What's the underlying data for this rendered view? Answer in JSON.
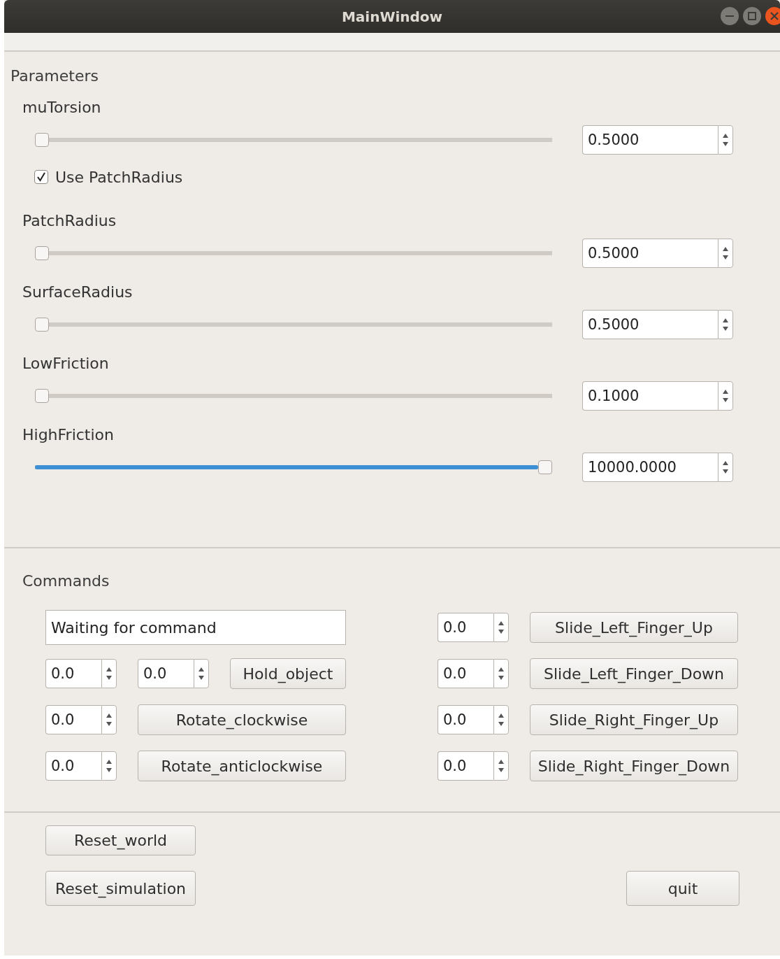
{
  "window": {
    "title": "MainWindow"
  },
  "parameters": {
    "title": "Parameters",
    "items": [
      {
        "kind": "slider",
        "label": "muTorsion",
        "level": 0,
        "value": "0.5000"
      },
      {
        "kind": "checkbox",
        "label": "Use PatchRadius",
        "checked": true
      },
      {
        "kind": "slider",
        "label": "PatchRadius",
        "level": 0,
        "value": "0.5000"
      },
      {
        "kind": "slider",
        "label": "SurfaceRadius",
        "level": 0,
        "value": "0.5000"
      },
      {
        "kind": "slider",
        "label": "LowFriction",
        "level": 0,
        "value": "0.1000"
      },
      {
        "kind": "slider",
        "label": "HighFriction",
        "level": 1,
        "value": "10000.0000"
      }
    ]
  },
  "commands": {
    "title": "Commands",
    "rows": [
      {
        "left": [
          {
            "kind": "status",
            "value": "Waiting for command"
          }
        ],
        "right": {
          "value": "0.0",
          "button": "Slide_Left_Finger_Up"
        }
      },
      {
        "left": [
          {
            "kind": "spin",
            "value": "0.0"
          },
          {
            "kind": "spin",
            "value": "0.0"
          },
          {
            "kind": "button",
            "label": "Hold_object"
          }
        ],
        "right": {
          "value": "0.0",
          "button": "Slide_Left_Finger_Down"
        }
      },
      {
        "left": [
          {
            "kind": "spin",
            "value": "0.0"
          },
          {
            "kind": "button",
            "label": "Rotate_clockwise"
          }
        ],
        "right": {
          "value": "0.0",
          "button": "Slide_Right_Finger_Up"
        }
      },
      {
        "left": [
          {
            "kind": "spin",
            "value": "0.0"
          },
          {
            "kind": "button",
            "label": "Rotate_anticlockwise"
          }
        ],
        "right": {
          "value": "0.0",
          "button": "Slide_Right_Finger_Down"
        }
      }
    ]
  },
  "footer": {
    "reset_world": "Reset_world",
    "reset_simulation": "Reset_simulation",
    "quit": "quit"
  }
}
